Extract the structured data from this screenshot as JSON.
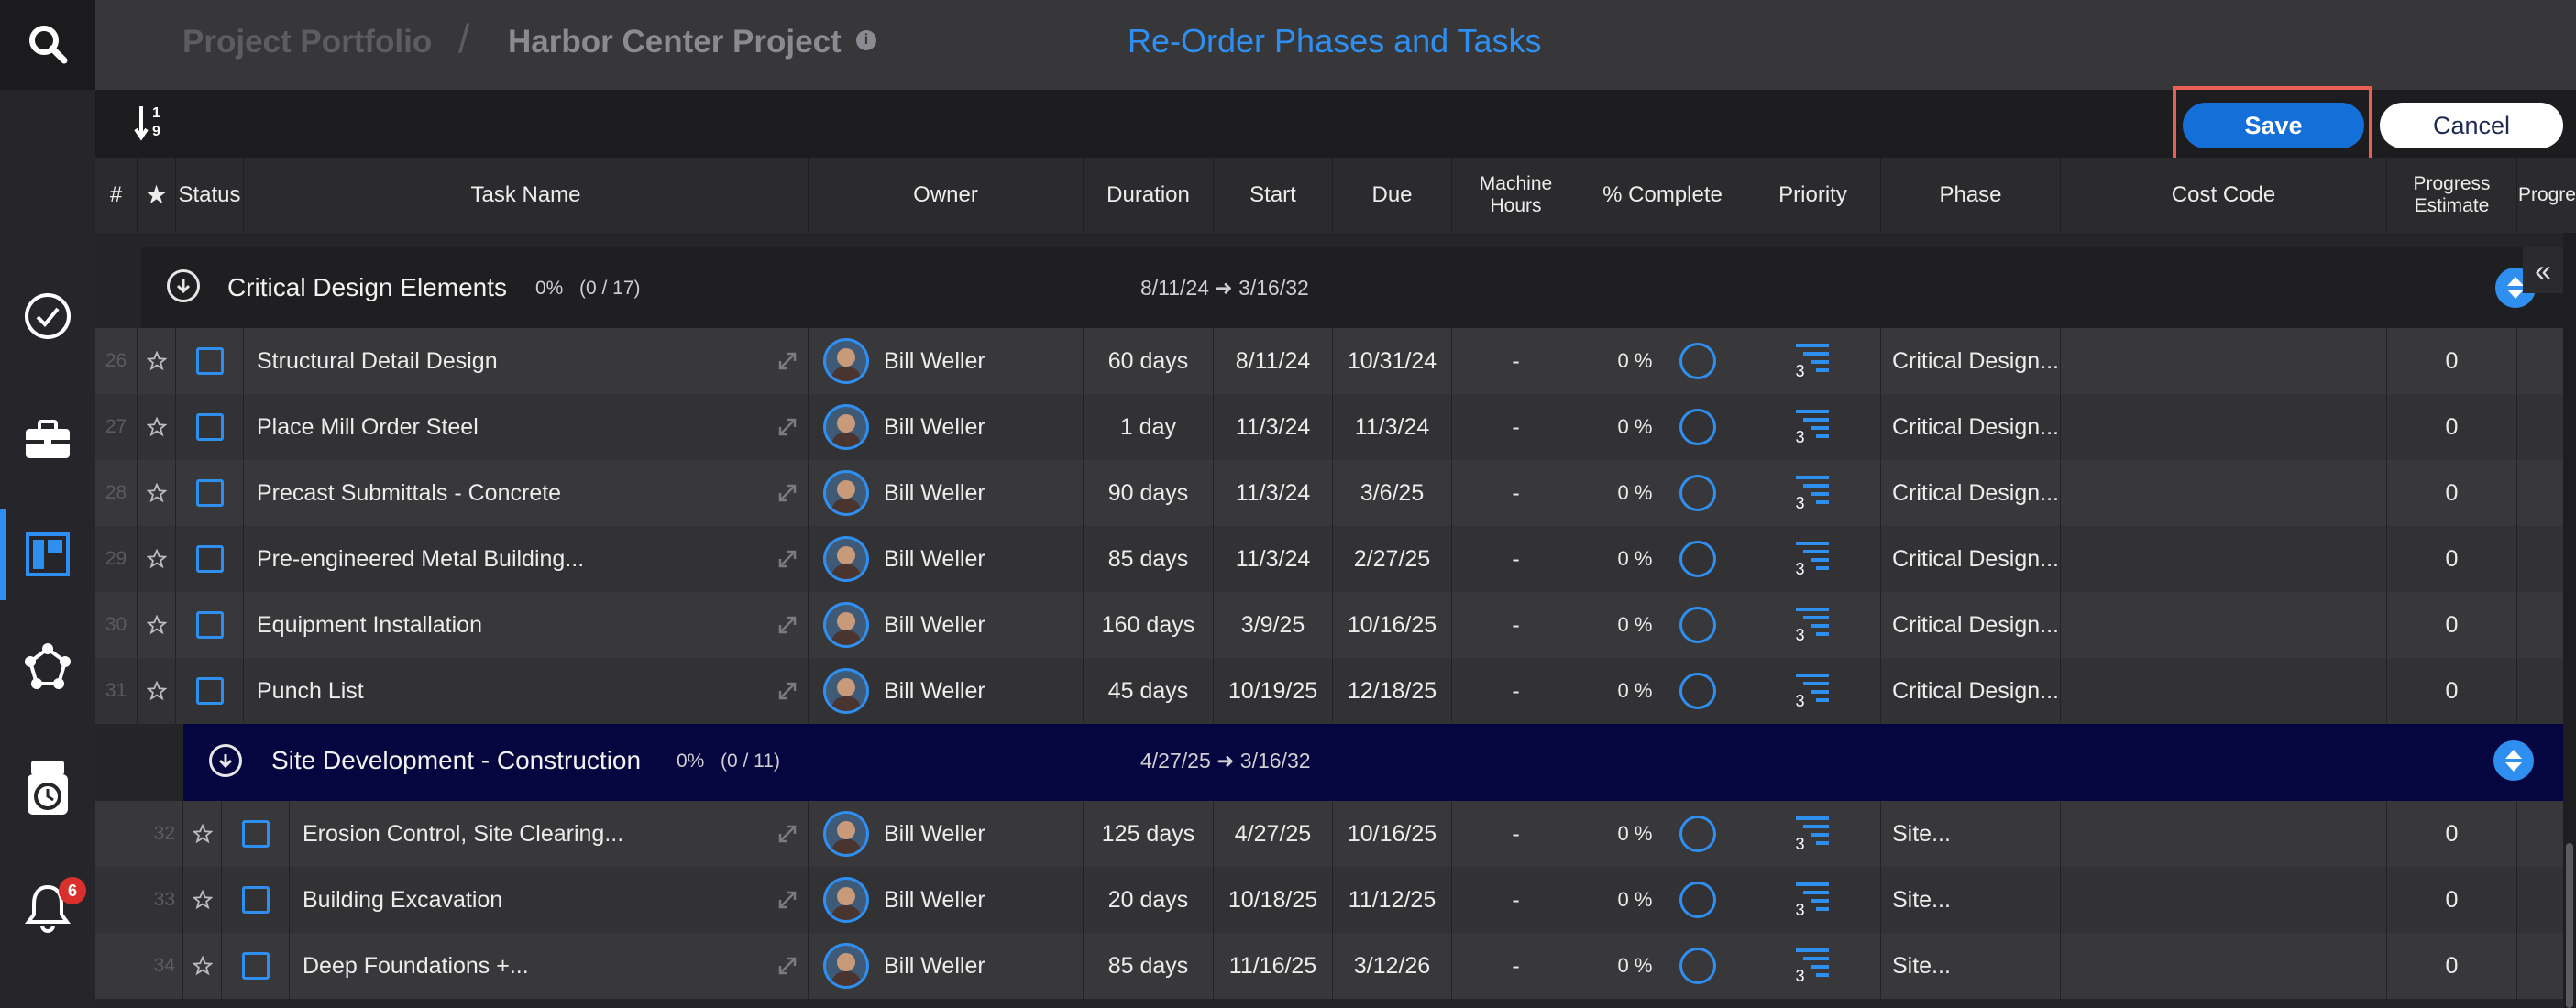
{
  "header": {
    "breadcrumb_portfolio": "Project Portfolio",
    "breadcrumb_separator": "/",
    "breadcrumb_project": "Harbor Center Project",
    "info_glyph": "i",
    "title": "Re-Order Phases and Tasks"
  },
  "toolbar": {
    "sort_icon": "sort-numeric-icon",
    "save_label": "Save",
    "cancel_label": "Cancel"
  },
  "rail": {
    "icons": [
      "search-icon",
      "check-circle-icon",
      "briefcase-icon",
      "board-icon",
      "network-icon",
      "timeclock-icon",
      "bell-icon"
    ],
    "notification_count": "6"
  },
  "columns": {
    "num": "#",
    "star": "★",
    "status": "Status",
    "task_name": "Task Name",
    "owner": "Owner",
    "duration": "Duration",
    "start": "Start",
    "due": "Due",
    "machine_hours": "Machine Hours",
    "pct_complete": "% Complete",
    "priority": "Priority",
    "phase": "Phase",
    "cost_code": "Cost Code",
    "progress_estimate": "Progress Estimate",
    "progress_actual": "Progress Actual"
  },
  "groups": [
    {
      "name": "Critical Design Elements",
      "pct": "0%",
      "count": "(0 / 17)",
      "dates": "8/11/24 ➜ 3/16/32"
    },
    {
      "name": "Site Development - Construction",
      "pct": "0%",
      "count": "(0 / 11)",
      "dates": "4/27/25 ➜ 3/16/32"
    }
  ],
  "tasks": [
    {
      "num": "26",
      "name": "Structural Detail Design",
      "owner": "Bill Weller",
      "duration": "60 days",
      "start": "8/11/24",
      "due": "10/31/24",
      "machine": "-",
      "pct": "0 %",
      "priority": "3",
      "phase": "Critical Design...",
      "estimate": "0"
    },
    {
      "num": "27",
      "name": "Place Mill Order Steel",
      "owner": "Bill Weller",
      "duration": "1 day",
      "start": "11/3/24",
      "due": "11/3/24",
      "machine": "-",
      "pct": "0 %",
      "priority": "3",
      "phase": "Critical Design...",
      "estimate": "0"
    },
    {
      "num": "28",
      "name": "Precast Submittals - Concrete",
      "owner": "Bill Weller",
      "duration": "90 days",
      "start": "11/3/24",
      "due": "3/6/25",
      "machine": "-",
      "pct": "0 %",
      "priority": "3",
      "phase": "Critical Design...",
      "estimate": "0"
    },
    {
      "num": "29",
      "name": "Pre-engineered Metal Building...",
      "owner": "Bill Weller",
      "duration": "85 days",
      "start": "11/3/24",
      "due": "2/27/25",
      "machine": "-",
      "pct": "0 %",
      "priority": "3",
      "phase": "Critical Design...",
      "estimate": "0"
    },
    {
      "num": "30",
      "name": "Equipment Installation",
      "owner": "Bill Weller",
      "duration": "160 days",
      "start": "3/9/25",
      "due": "10/16/25",
      "machine": "-",
      "pct": "0 %",
      "priority": "3",
      "phase": "Critical Design...",
      "estimate": "0"
    },
    {
      "num": "31",
      "name": "Punch List",
      "owner": "Bill Weller",
      "duration": "45 days",
      "start": "10/19/25",
      "due": "12/18/25",
      "machine": "-",
      "pct": "0 %",
      "priority": "3",
      "phase": "Critical Design...",
      "estimate": "0"
    },
    {
      "num": "32",
      "name": "Erosion Control, Site Clearing...",
      "owner": "Bill Weller",
      "duration": "125 days",
      "start": "4/27/25",
      "due": "10/16/25",
      "machine": "-",
      "pct": "0 %",
      "priority": "3",
      "phase": "Site...",
      "estimate": "0"
    },
    {
      "num": "33",
      "name": "Building Excavation",
      "owner": "Bill Weller",
      "duration": "20 days",
      "start": "10/18/25",
      "due": "11/12/25",
      "machine": "-",
      "pct": "0 %",
      "priority": "3",
      "phase": "Site...",
      "estimate": "0"
    },
    {
      "num": "34",
      "name": "Deep Foundations +...",
      "owner": "Bill Weller",
      "duration": "85 days",
      "start": "11/16/25",
      "due": "3/12/26",
      "machine": "-",
      "pct": "0 %",
      "priority": "3",
      "phase": "Site...",
      "estimate": "0"
    }
  ],
  "panel_toggle": "«",
  "colors": {
    "accent": "#2f8ff0",
    "save_outline": "#e86052",
    "group2_bg": "#05063f",
    "notification": "#d9302c"
  }
}
